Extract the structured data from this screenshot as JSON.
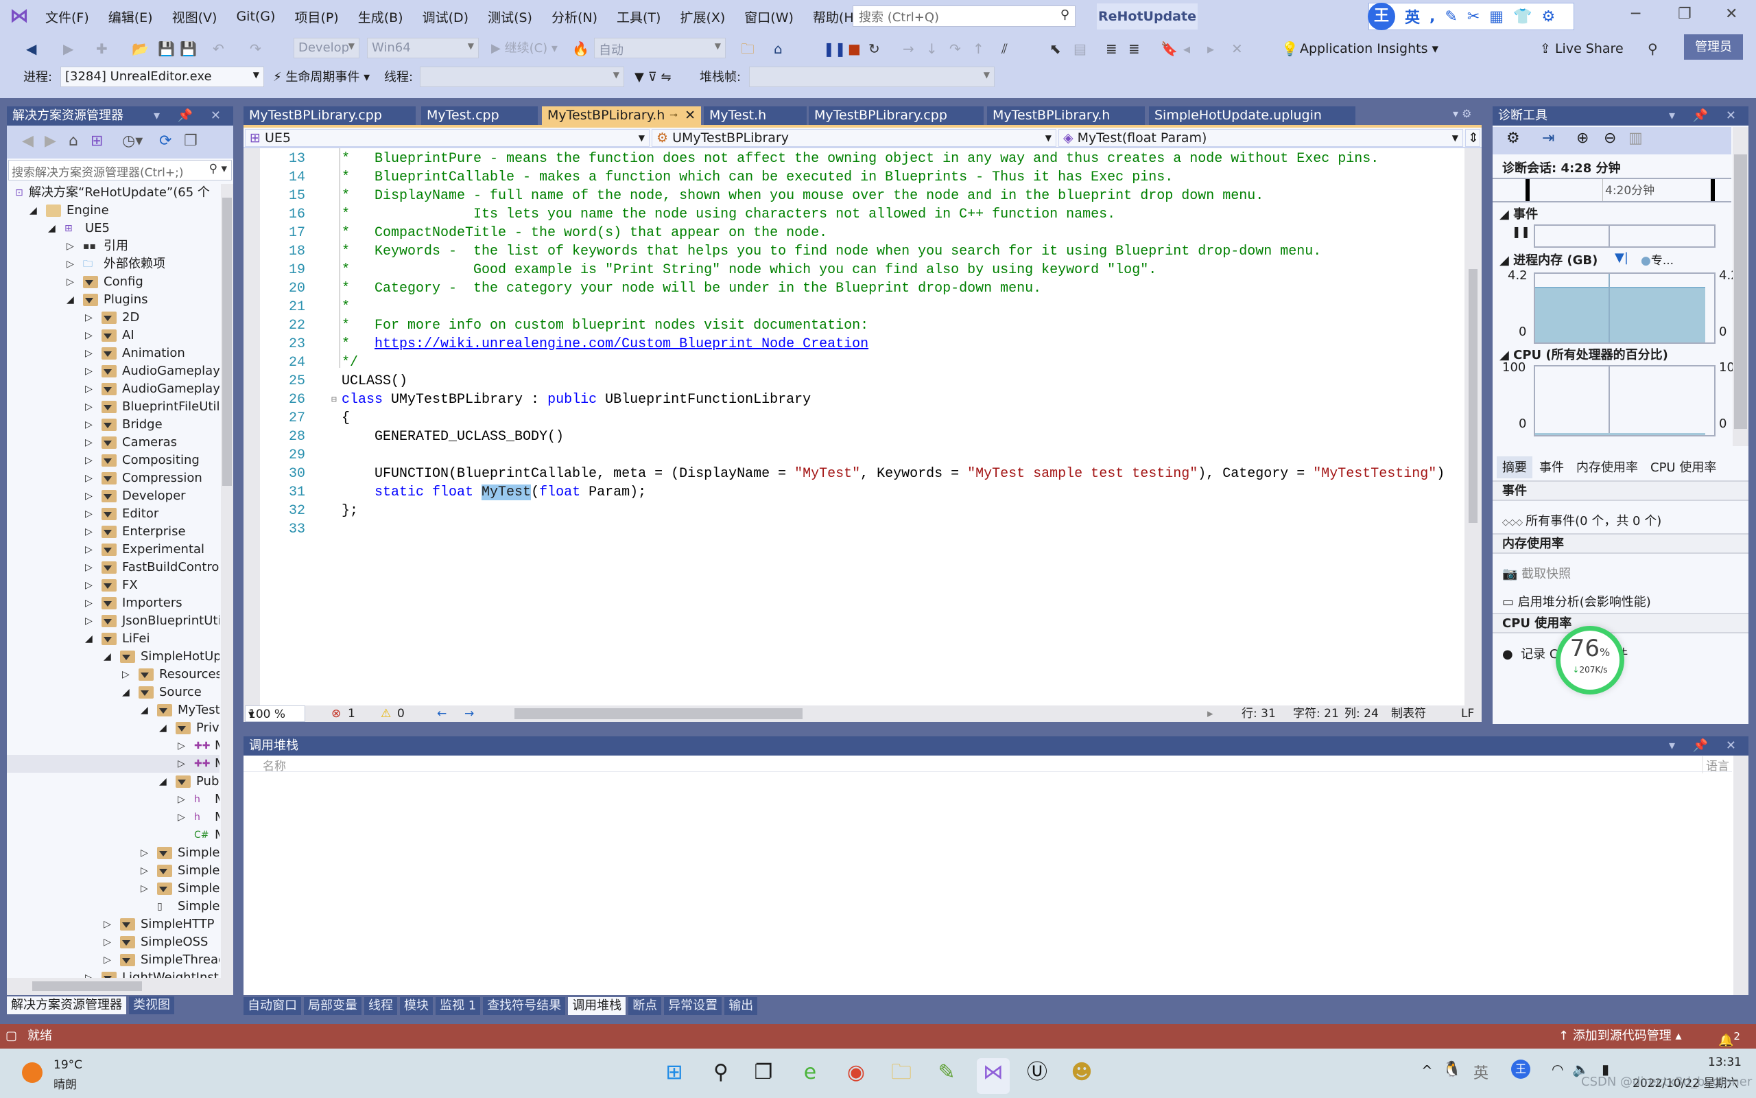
{
  "menu": [
    "文件(F)",
    "编辑(E)",
    "视图(V)",
    "Git(G)",
    "项目(P)",
    "生成(B)",
    "调试(D)",
    "测试(S)",
    "分析(N)",
    "工具(T)",
    "扩展(X)",
    "窗口(W)",
    "帮助(H)"
  ],
  "search": {
    "placeholder": "搜索 (Ctrl+Q)"
  },
  "solution_name": "ReHotUpdate",
  "ime": {
    "mode": "英",
    "logo": "王"
  },
  "toolbar": {
    "config": "Develop",
    "platform": "Win64",
    "continue": "继续(C)",
    "auto": "自动",
    "app_insights": "Application Insights",
    "live_share": "Live Share",
    "admin": "管理员"
  },
  "toolbar2": {
    "process_label": "进程:",
    "process_value": "[3284] UnrealEditor.exe",
    "lifecycle": "生命周期事件",
    "thread_label": "线程:",
    "stack_label": "堆栈帧:"
  },
  "solution_explorer": {
    "title": "解决方案资源管理器",
    "search_placeholder": "搜索解决方案资源管理器(Ctrl+;)",
    "tree": [
      {
        "label": "解决方案“ReHotUpdate”(65 个",
        "level": 0,
        "exp": "none",
        "icon": "solution"
      },
      {
        "label": "Engine",
        "level": 1,
        "exp": "open",
        "icon": "folder-open"
      },
      {
        "label": "UE5",
        "level": 2,
        "exp": "open",
        "icon": "project"
      },
      {
        "label": "引用",
        "level": 3,
        "exp": "closed",
        "icon": "references"
      },
      {
        "label": "外部依赖项",
        "level": 3,
        "exp": "closed",
        "icon": "external"
      },
      {
        "label": "Config",
        "level": 3,
        "exp": "closed",
        "icon": "filter"
      },
      {
        "label": "Plugins",
        "level": 3,
        "exp": "open",
        "icon": "filter"
      },
      {
        "label": "2D",
        "level": 4,
        "exp": "closed",
        "icon": "filter"
      },
      {
        "label": "AI",
        "level": 4,
        "exp": "closed",
        "icon": "filter"
      },
      {
        "label": "Animation",
        "level": 4,
        "exp": "closed",
        "icon": "filter"
      },
      {
        "label": "AudioGameplay",
        "level": 4,
        "exp": "closed",
        "icon": "filter"
      },
      {
        "label": "AudioGameplayV",
        "level": 4,
        "exp": "closed",
        "icon": "filter"
      },
      {
        "label": "BlueprintFileUtils",
        "level": 4,
        "exp": "closed",
        "icon": "filter"
      },
      {
        "label": "Bridge",
        "level": 4,
        "exp": "closed",
        "icon": "filter"
      },
      {
        "label": "Cameras",
        "level": 4,
        "exp": "closed",
        "icon": "filter"
      },
      {
        "label": "Compositing",
        "level": 4,
        "exp": "closed",
        "icon": "filter"
      },
      {
        "label": "Compression",
        "level": 4,
        "exp": "closed",
        "icon": "filter"
      },
      {
        "label": "Developer",
        "level": 4,
        "exp": "closed",
        "icon": "filter"
      },
      {
        "label": "Editor",
        "level": 4,
        "exp": "closed",
        "icon": "filter"
      },
      {
        "label": "Enterprise",
        "level": 4,
        "exp": "closed",
        "icon": "filter"
      },
      {
        "label": "Experimental",
        "level": 4,
        "exp": "closed",
        "icon": "filter"
      },
      {
        "label": "FastBuildControl",
        "level": 4,
        "exp": "closed",
        "icon": "filter"
      },
      {
        "label": "FX",
        "level": 4,
        "exp": "closed",
        "icon": "filter"
      },
      {
        "label": "Importers",
        "level": 4,
        "exp": "closed",
        "icon": "filter"
      },
      {
        "label": "JsonBlueprintUtil",
        "level": 4,
        "exp": "closed",
        "icon": "filter"
      },
      {
        "label": "LiFei",
        "level": 4,
        "exp": "open",
        "icon": "filter"
      },
      {
        "label": "SimpleHotUp",
        "level": 5,
        "exp": "open",
        "icon": "filter"
      },
      {
        "label": "Resources",
        "level": 6,
        "exp": "closed",
        "icon": "filter"
      },
      {
        "label": "Source",
        "level": 6,
        "exp": "open",
        "icon": "filter"
      },
      {
        "label": "MyTest",
        "level": 7,
        "exp": "open",
        "icon": "filter"
      },
      {
        "label": "Priva",
        "level": 8,
        "exp": "open",
        "icon": "filter"
      },
      {
        "label": "M",
        "level": 9,
        "exp": "closed",
        "icon": "cpp"
      },
      {
        "label": "M",
        "level": 9,
        "exp": "closed",
        "icon": "cpp",
        "selected": true
      },
      {
        "label": "Pub",
        "level": 8,
        "exp": "open",
        "icon": "filter"
      },
      {
        "label": "M",
        "level": 9,
        "exp": "closed",
        "icon": "header"
      },
      {
        "label": "M",
        "level": 9,
        "exp": "closed",
        "icon": "header"
      },
      {
        "label": "MyT",
        "level": 9,
        "exp": "none",
        "icon": "csharp"
      },
      {
        "label": "Simple",
        "level": 7,
        "exp": "closed",
        "icon": "filter"
      },
      {
        "label": "Simple",
        "level": 7,
        "exp": "closed",
        "icon": "filter"
      },
      {
        "label": "Simple",
        "level": 7,
        "exp": "closed",
        "icon": "filter"
      },
      {
        "label": "SimpleHot",
        "level": 7,
        "exp": "none",
        "icon": "file"
      },
      {
        "label": "SimpleHTTP",
        "level": 5,
        "exp": "closed",
        "icon": "filter"
      },
      {
        "label": "SimpleOSS",
        "level": 5,
        "exp": "closed",
        "icon": "filter"
      },
      {
        "label": "SimpleThread",
        "level": 5,
        "exp": "closed",
        "icon": "filter"
      },
      {
        "label": "LightWeightInsta",
        "level": 4,
        "exp": "closed",
        "icon": "filter"
      }
    ],
    "bottom_tabs": [
      {
        "label": "解决方案资源管理器",
        "active": true
      },
      {
        "label": "类视图",
        "active": false
      }
    ]
  },
  "editor": {
    "tabs": [
      {
        "label": "MyTestBPLibrary.cpp",
        "active": false
      },
      {
        "label": "MyTest.cpp",
        "active": false
      },
      {
        "label": "MyTestBPLibrary.h",
        "active": true
      },
      {
        "label": "MyTest.h",
        "active": false
      },
      {
        "label": "MyTestBPLibrary.cpp",
        "active": false
      },
      {
        "label": "MyTestBPLibrary.h",
        "active": false
      },
      {
        "label": "SimpleHotUpdate.uplugin",
        "active": false
      }
    ],
    "nav": {
      "project": "UE5",
      "class": "UMyTestBPLibrary",
      "member": "MyTest(float Param)"
    },
    "lines": [
      {
        "n": 13,
        "tokens": [
          [
            "comment",
            "*   BlueprintPure - means the function does not affect the owning object in any way and thus creates a node without Exec pins."
          ]
        ]
      },
      {
        "n": 14,
        "tokens": [
          [
            "comment",
            "*   BlueprintCallable - makes a function which can be executed in Blueprints - Thus it has Exec pins."
          ]
        ]
      },
      {
        "n": 15,
        "tokens": [
          [
            "comment",
            "*   DisplayName - full name of the node, shown when you mouse over the node and in the blueprint drop down menu."
          ]
        ]
      },
      {
        "n": 16,
        "tokens": [
          [
            "comment",
            "*               Its lets you name the node using characters not allowed in C++ function names."
          ]
        ]
      },
      {
        "n": 17,
        "tokens": [
          [
            "comment",
            "*   CompactNodeTitle - the word(s) that appear on the node."
          ]
        ]
      },
      {
        "n": 18,
        "tokens": [
          [
            "comment",
            "*   Keywords -  the list of keywords that helps you to find node when you search for it using Blueprint drop-down menu."
          ]
        ]
      },
      {
        "n": 19,
        "tokens": [
          [
            "comment",
            "*               Good example is \"Print String\" node which you can find also by using keyword \"log\"."
          ]
        ]
      },
      {
        "n": 20,
        "tokens": [
          [
            "comment",
            "*   Category -  the category your node will be under in the Blueprint drop-down menu."
          ]
        ]
      },
      {
        "n": 21,
        "tokens": [
          [
            "comment",
            "*"
          ]
        ]
      },
      {
        "n": 22,
        "tokens": [
          [
            "comment",
            "*   For more info on custom blueprint nodes visit documentation:"
          ]
        ]
      },
      {
        "n": 23,
        "tokens": [
          [
            "comment",
            "*   "
          ],
          [
            "link",
            "https://wiki.unrealengine.com/Custom_Blueprint_Node_Creation"
          ]
        ]
      },
      {
        "n": 24,
        "tokens": [
          [
            "comment",
            "*/"
          ]
        ]
      },
      {
        "n": 25,
        "tokens": [
          [
            "plain",
            "UCLASS()"
          ]
        ]
      },
      {
        "n": 26,
        "tokens": [
          [
            "kw",
            "class"
          ],
          [
            "plain",
            " UMyTestBPLibrary : "
          ],
          [
            "kw",
            "public"
          ],
          [
            "plain",
            " UBlueprintFunctionLibrary"
          ]
        ]
      },
      {
        "n": 27,
        "tokens": [
          [
            "plain",
            "{"
          ]
        ]
      },
      {
        "n": 28,
        "tokens": [
          [
            "plain",
            "    GENERATED_UCLASS_BODY()"
          ]
        ]
      },
      {
        "n": 29,
        "tokens": []
      },
      {
        "n": 30,
        "tokens": [
          [
            "plain",
            "    UFUNCTION(BlueprintCallable, meta = (DisplayName = "
          ],
          [
            "str",
            "\"MyTest\""
          ],
          [
            "plain",
            ", Keywords = "
          ],
          [
            "str",
            "\"MyTest sample test testing\""
          ],
          [
            "plain",
            "), Category = "
          ],
          [
            "str",
            "\"MyTestTesting\""
          ],
          [
            "plain",
            ")"
          ]
        ]
      },
      {
        "n": 31,
        "tokens": [
          [
            "plain",
            "    "
          ],
          [
            "kw",
            "static float "
          ],
          [
            "sel",
            "MyTest"
          ],
          [
            "plain",
            "("
          ],
          [
            "kw",
            "float"
          ],
          [
            "plain",
            " Param);"
          ]
        ]
      },
      {
        "n": 32,
        "tokens": [
          [
            "plain",
            "};"
          ]
        ]
      },
      {
        "n": 33,
        "tokens": []
      }
    ],
    "status": {
      "zoom": "100 %",
      "errors": "1",
      "warnings": "0",
      "line": "行: 31",
      "char": "字符: 21",
      "col": "列: 24",
      "tabs": "制表符",
      "eol": "LF"
    }
  },
  "diagnostics": {
    "title": "诊断工具",
    "session": "诊断会话: 4:28 分钟",
    "timeline_label": "4:20分钟",
    "events_label": "事件",
    "memory_label": "进程内存 (GB)",
    "memory_legend": "专...",
    "memory_max": "4.2",
    "memory_min": "0",
    "memory_level_gb": 3.4,
    "cpu_label": "CPU (所有处理器的百分比)",
    "cpu_max": "100",
    "cpu_max_right": "10",
    "cpu_min": "0",
    "tabs": [
      {
        "label": "摘要",
        "active": true
      },
      {
        "label": "事件"
      },
      {
        "label": "内存使用率"
      },
      {
        "label": "CPU 使用率"
      }
    ],
    "sec_events": "事件",
    "all_events": "所有事件(0 个，共 0 个)",
    "sec_memory": "内存使用率",
    "snapshot": "截取快照",
    "heap": "启用堆分析(会影响性能)",
    "sec_cpu": "CPU 使用率",
    "record_cpu": "记录 CPU 配置文件"
  },
  "net_widget": {
    "percent": "76",
    "unit": "%",
    "speed": "207K/s"
  },
  "callstack": {
    "title": "调用堆栈",
    "col_name": "名称",
    "col_lang": "语言"
  },
  "bottom_tabs": [
    {
      "label": "自动窗口"
    },
    {
      "label": "局部变量"
    },
    {
      "label": "线程"
    },
    {
      "label": "模块"
    },
    {
      "label": "监视 1"
    },
    {
      "label": "查找符号结果"
    },
    {
      "label": "调用堆栈",
      "active": true
    },
    {
      "label": "断点"
    },
    {
      "label": "异常设置"
    },
    {
      "label": "输出"
    }
  ],
  "statusbar": {
    "ready": "就绪",
    "source_control": "添加到源代码管理",
    "notifications": "2"
  },
  "taskbar": {
    "temp": "19°C",
    "weather": "晴朗",
    "ime": "英",
    "time": "13:31",
    "date": "2022/10/22 星期六",
    "watermark": "CSDN @directx3d_beginner"
  }
}
